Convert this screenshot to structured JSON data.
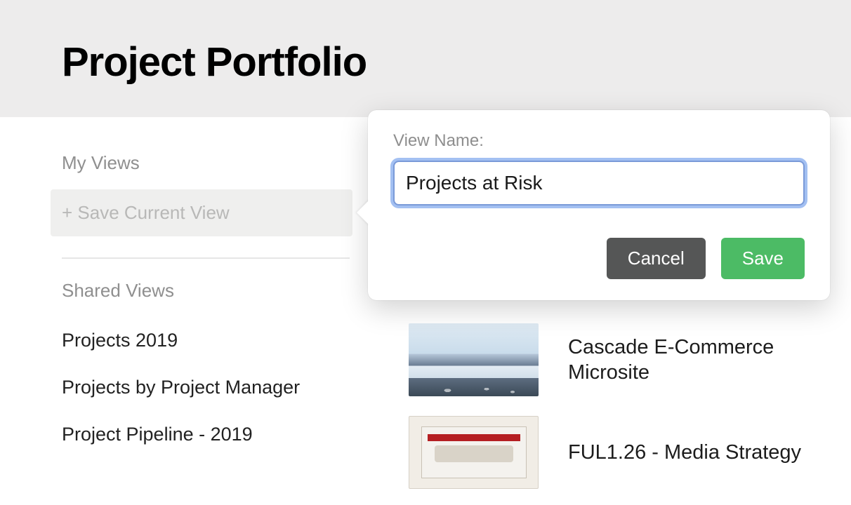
{
  "header": {
    "title": "Project Portfolio"
  },
  "sidebar": {
    "my_views_label": "My Views",
    "save_view_label": "+ Save Current View",
    "shared_views_label": "Shared Views",
    "shared_items": [
      {
        "label": "Projects 2019"
      },
      {
        "label": "Projects by Project Manager"
      },
      {
        "label": "Project Pipeline - 2019"
      }
    ]
  },
  "popover": {
    "field_label": "View Name:",
    "input_value": "Projects at Risk",
    "cancel_label": "Cancel",
    "save_label": "Save"
  },
  "projects": [
    {
      "title": "Cascade E-Commerce Microsite",
      "thumb": "mountains"
    },
    {
      "title": "FUL1.26 - Media Strategy",
      "thumb": "cassette"
    }
  ]
}
